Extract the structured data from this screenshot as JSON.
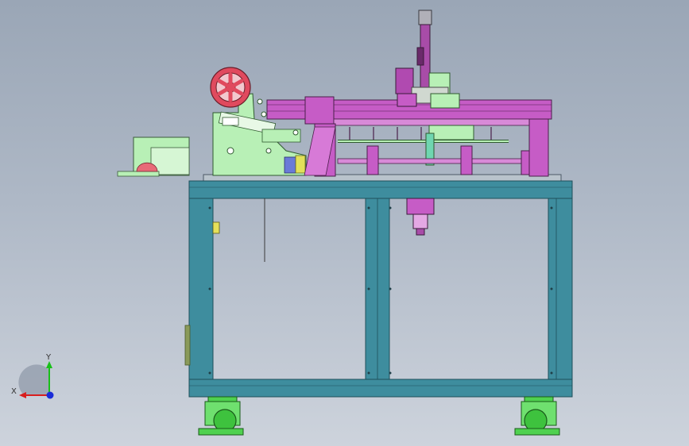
{
  "triad": {
    "x_label": "X",
    "y_label": "Y"
  },
  "colors": {
    "background_top": "#9aa6b6",
    "background_bottom": "#cdd3dc",
    "frame_teal": "#3e8d9e",
    "frame_edge": "#1f4f5a",
    "machine_green": "#b8f0b6",
    "machine_purple": "#c65cc6",
    "wheel_red": "#e04a5e",
    "caster_green": "#4fd14f",
    "axis_x": "#d81e1e",
    "axis_y": "#19c019",
    "axis_z": "#1a2cd8"
  }
}
